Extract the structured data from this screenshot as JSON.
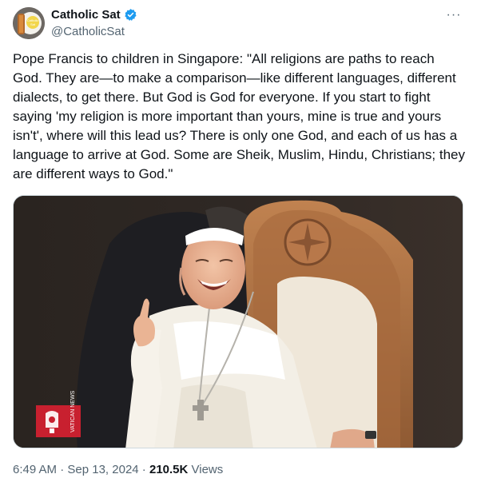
{
  "author": {
    "display_name": "Catholic Sat",
    "handle": "@CatholicSat",
    "avatar_label": "Catholic Sat",
    "verified_color": "#1d9bf0"
  },
  "more_glyph": "···",
  "tweet_text": "Pope Francis to children in Singapore: \"All religions are paths to reach God. They are—to make a comparison—like different languages, different dialects, to get there. But God is God for everyone. If you start to fight saying 'my religion is more important than yours, mine is true and yours isn't', where will this lead us? There is only one God, and each of us has a language to arrive at God. Some are Sheik, Muslim, Hindu, Christians; they are different ways to God.\"",
  "media": {
    "watermark": "VATICAN NEWS",
    "badge_color": "#c8202f"
  },
  "meta": {
    "time": "6:49 AM",
    "separator": " · ",
    "date": "Sep 13, 2024",
    "views_count": "210.5K",
    "views_label": " Views"
  }
}
